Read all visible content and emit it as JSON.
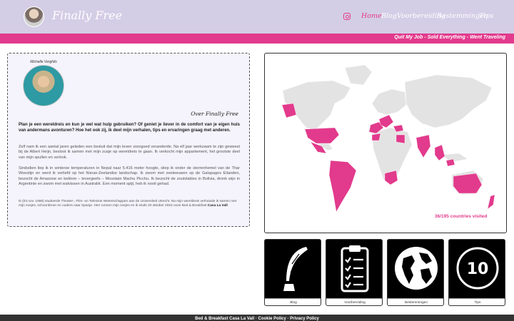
{
  "header": {
    "site_title": "Finally Free",
    "nav": [
      "Home",
      "Blog",
      "Voorbereiding",
      "Bestemmingen",
      "Tips"
    ],
    "active_nav": "Home"
  },
  "banner": {
    "tagline": "Quit My Job - Sold Everything - Went Traveling"
  },
  "about": {
    "portrait_caption": "Michelle Verghils",
    "title": "Over Finally Free",
    "lead": "Plan je een wereldreis en kun je wel wat hulp gebruiken? Of geniet je liever in de comfort van je eigen huis van andermans avonturen? Hoe het ook zij, ik deel mijn verhalen, tips en ervaringen graag met anderen.",
    "p1": "Zelf nam ik een aantal jaren geleden een besluit dat mijn leven voorgoed veranderde. Na elf jaar werkzaam te zijn geweest bij de Albert Heijn, besloot ik samen met mijn zusje op wereldreis te gaan. Ik verkocht mijn appartement, het grootste deel van mijn spullen en vertrok.",
    "p2": "Sindsdien liep ik in winterse temperaturen in Nepal naar 5.416 meter hoogte, sliep ik onder de sterrenhemel van de Thar Woestijn en werd ik verliefd op het Nieuw-Zeelandse landschap. Ik zwom met zeeleeuwen op de Galapagos Eilanden, bezocht de Amazone en beklom – tevergeefs – Mountain Machu Picchu. Ik bezocht de zoutvlaktes in Bolivia, dronk wijn in Argentinie en zwom met walvissen in Australië. Een moment spijt, heb ik nooit gehad.",
    "foot": "Ik (03 nov. 1986) studeerde Theater-, Film- en Televisie Wetenschappen aan de Universiteit Utrecht. Na mijn wereldreis verhuisde ik samen met mijn zusjes, schoonbroer en ouders naar Spanje. Hier runnen mijn zusjes en ik sinds 20 oktober 2023 onze Bed & Breakfast ",
    "foot_link": "Casa La Vall"
  },
  "map": {
    "visited_text": "36/195 countries visited",
    "highlight_color": "#e23a8c",
    "land_color": "#e3e3e3"
  },
  "tiles": [
    {
      "label": "Blog",
      "icon": "quill-icon"
    },
    {
      "label": "Voorbereiding",
      "icon": "clipboard-checklist-icon"
    },
    {
      "label": "Bestemmingen",
      "icon": "globe-icon"
    },
    {
      "label": "Tips",
      "icon": "number-ten-icon",
      "number": "10"
    }
  ],
  "footer": {
    "text": "Bed & Breakfast Casa La Vall · Cookie Policy · Privacy Policy"
  }
}
